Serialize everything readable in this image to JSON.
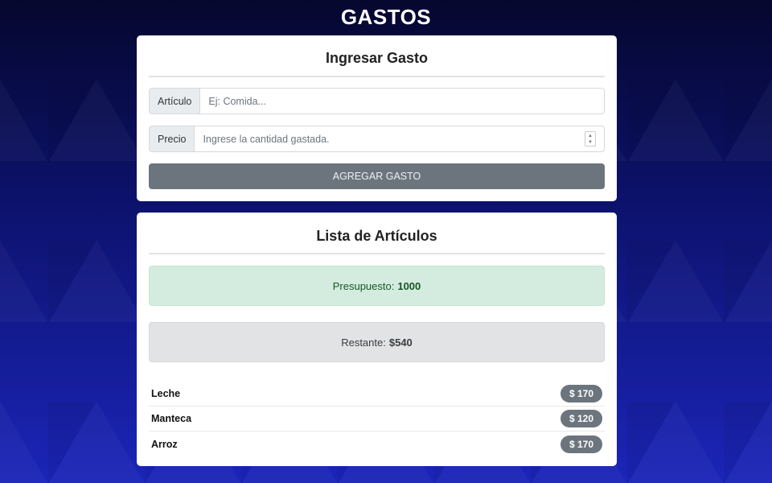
{
  "app": {
    "title": "GASTOS"
  },
  "form": {
    "title": "Ingresar Gasto",
    "article_label": "Artículo",
    "article_placeholder": "Ej: Comida...",
    "price_label": "Precio",
    "price_placeholder": "Ingrese la cantidad gastada.",
    "submit_label": "AGREGAR GASTO"
  },
  "list": {
    "title": "Lista de Artículos",
    "budget_label": "Presupuesto:",
    "budget_value": "1000",
    "remaining_label": "Restante:",
    "remaining_value": "$540",
    "items": [
      {
        "name": "Leche",
        "price": "$ 170"
      },
      {
        "name": "Manteca",
        "price": "$ 120"
      },
      {
        "name": "Arroz",
        "price": "$ 170"
      }
    ]
  },
  "colors": {
    "background_top": "#05072e",
    "background_bottom": "#1b25b8",
    "button": "#6c757d",
    "budget_alert": "#d4ecdf",
    "remaining_alert": "#e2e3e5"
  }
}
